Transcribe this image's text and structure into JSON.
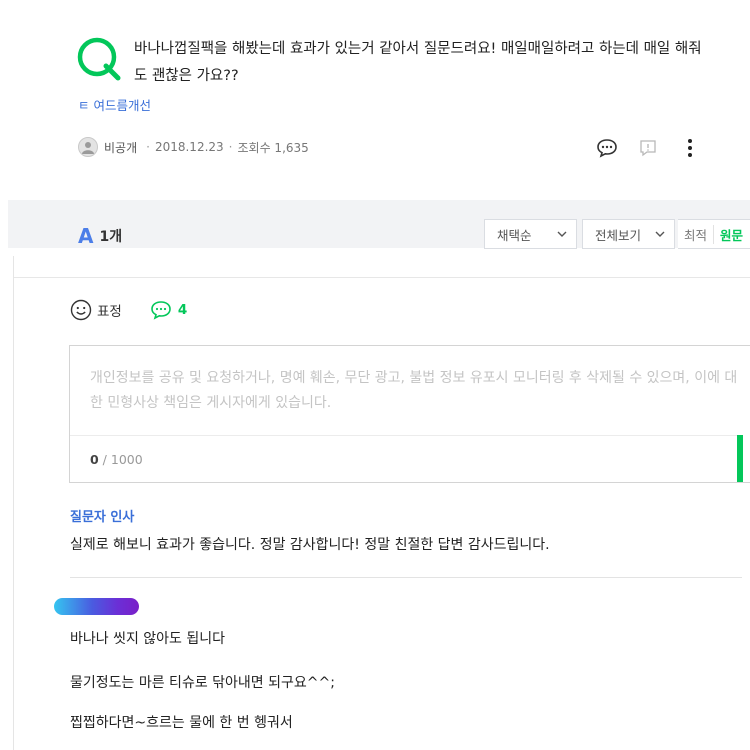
{
  "question": {
    "title": "바나나껍질팩을 해봤는데 효과가 있는거 같아서 질문드려요! 매일매일하려고 하는데 매일 해줘도 괜찮은 가요??",
    "tag": "ㅌ 여드름개선",
    "author": "비공개",
    "date": "2018.12.23",
    "views": "조회수 1,635",
    "separator": "·"
  },
  "answers": {
    "a_mark": "A",
    "count": "1개",
    "sort_dropdown": "채택순",
    "view_dropdown": "전체보기",
    "tab_latest": "최적",
    "tab_original": "원문"
  },
  "answer_panel": {
    "reaction_label": "표정",
    "comment_count": "4",
    "comment_placeholder": "개인정보를 공유 및 요청하거나, 명예 훼손, 무단 광고, 불법 정보 유포시 모니터링 후 삭제될 수 있으며, 이에 대한 민형사상 책임은 게시자에게 있습니다.",
    "counter_current": "0",
    "counter_max": " / 1000",
    "greeting_label": "질문자 인사",
    "greeting_text": "실제로 해보니 효과가 좋습니다. 정말 감사합니다! 정말 친절한 답변 감사드립니다.",
    "answer_lines": [
      "바나나 씻지 않아도 됩니다",
      "물기정도는 마른 티슈로 닦아내면 되구요^^;",
      "찝찝하다면~흐르는 물에 한 번 헹궈서"
    ]
  },
  "colors": {
    "naver_green": "#03c75a",
    "link_blue": "#3a6fd8",
    "band_gray": "#f2f3f5"
  },
  "icons": [
    "q-icon",
    "comment-icon",
    "report-icon",
    "more-icon",
    "smile-icon",
    "speech-bubble-icon",
    "chevron-down-icon"
  ]
}
